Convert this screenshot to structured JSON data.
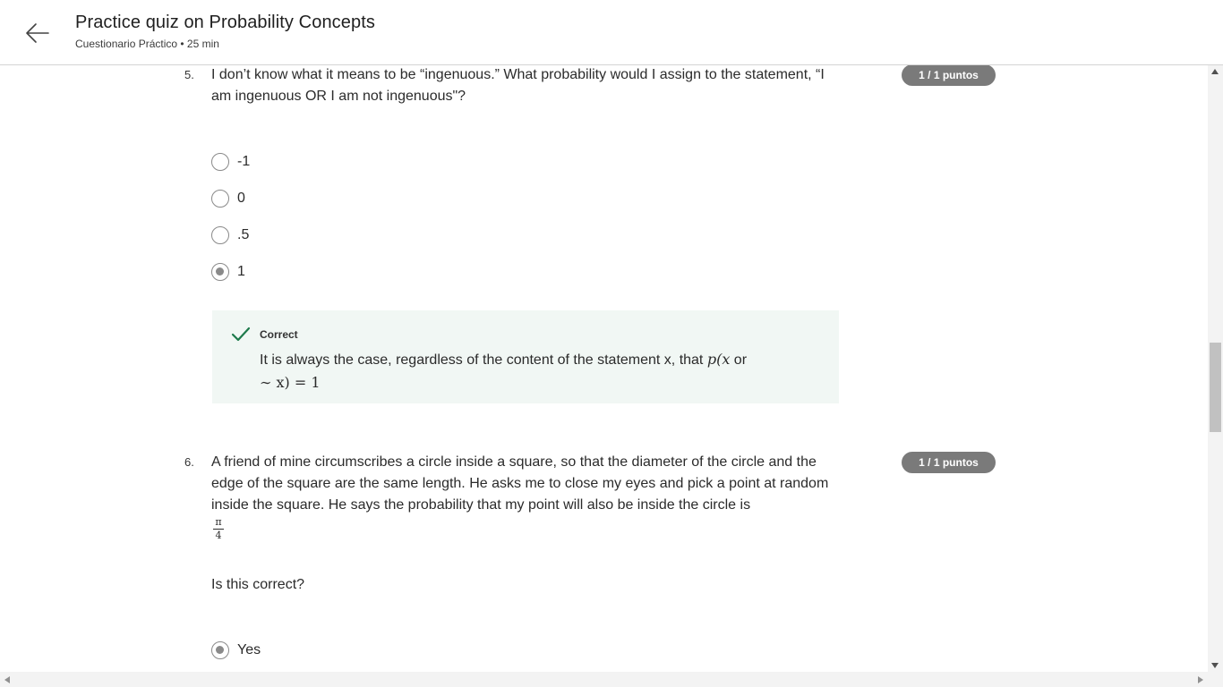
{
  "header": {
    "title": "Practice quiz on Probability Concepts",
    "subtitle": "Cuestionario Práctico • 25 min"
  },
  "questions": [
    {
      "number": "5.",
      "text": "I don’t know what it means to be “ingenuous.” What probability would I assign to the statement, “I am ingenuous OR I am not ingenuous\"?",
      "points": "1 / 1 puntos",
      "options": [
        {
          "label": "-1",
          "selected": false
        },
        {
          "label": "0",
          "selected": false
        },
        {
          "label": ".5",
          "selected": false
        },
        {
          "label": "1",
          "selected": true
        }
      ],
      "feedback": {
        "status": "Correct",
        "text_prefix": "It is always the case, regardless of the content of the statement x, that ",
        "math_line1": "p(x",
        "text_or": " or",
        "math_line2": "∼ x) = 1"
      }
    },
    {
      "number": "6.",
      "text": "A friend of mine circumscribes a circle inside a square, so that the diameter of the circle and the edge of the square are the same length. He asks me to close my eyes and pick a point at random inside the square. He says the probability that my point will also be inside the circle is",
      "fraction": {
        "numerator": "π",
        "denominator": "4"
      },
      "prompt": "Is this correct?",
      "points": "1 / 1 puntos",
      "options": [
        {
          "label": "Yes",
          "selected": true
        }
      ]
    }
  ],
  "colors": {
    "badge": "#7a7a7a",
    "feedback_bg": "#f1f7f4",
    "check": "#1e7a4b"
  }
}
